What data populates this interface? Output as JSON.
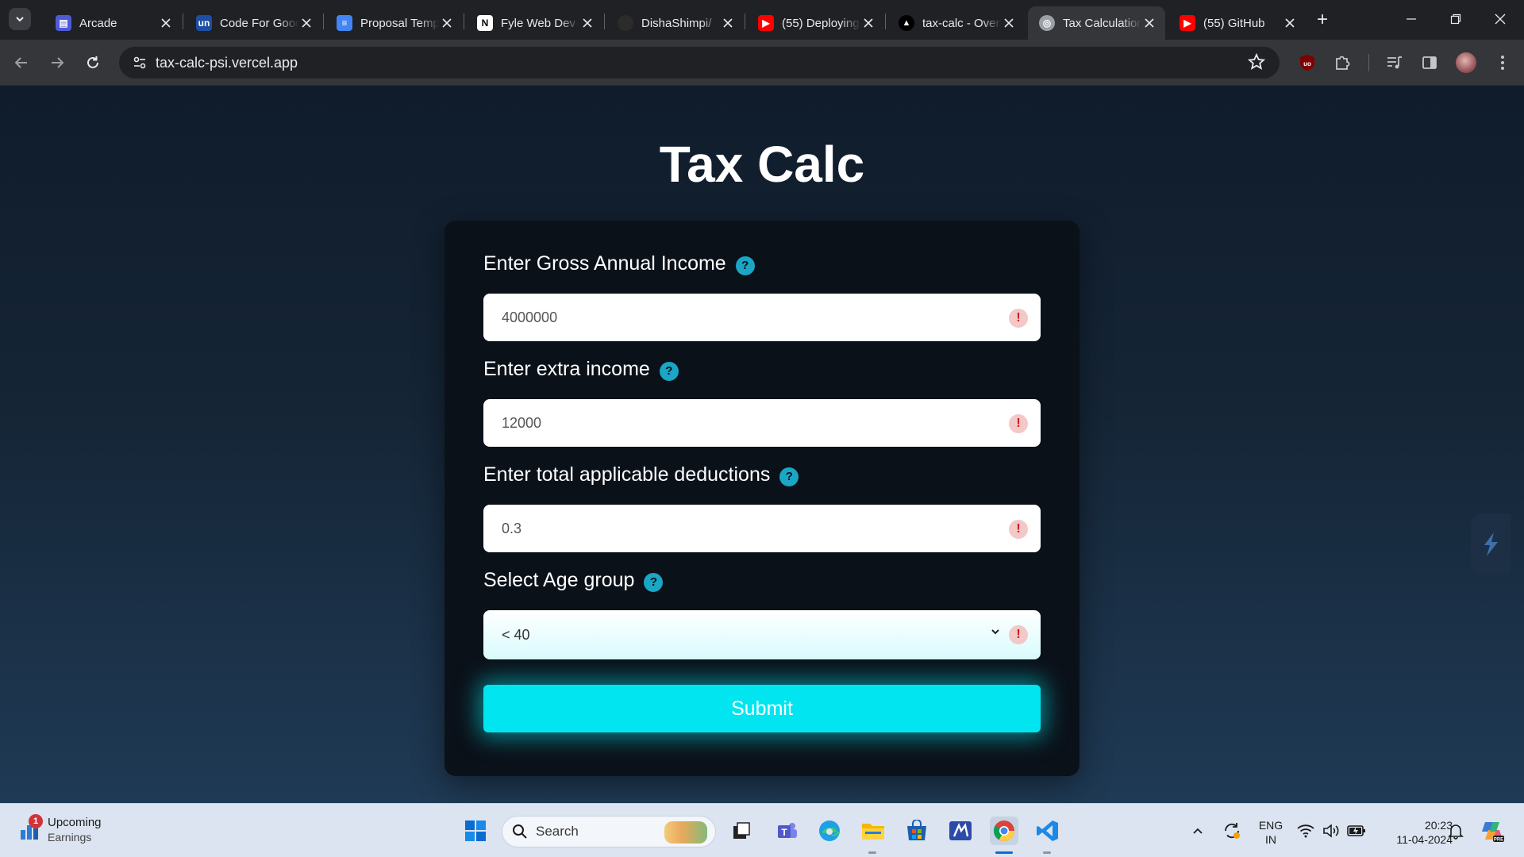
{
  "browser": {
    "tabs": [
      {
        "title": "Arcade",
        "favicon": "arcade-icon",
        "color": "#4f5bd5",
        "glyph": "▤"
      },
      {
        "title": "Code For Good",
        "favicon": "unstop-icon",
        "color": "#1c4fa3",
        "glyph": "un"
      },
      {
        "title": "Proposal Template",
        "favicon": "google-docs-icon",
        "color": "#4285f4",
        "glyph": "≡"
      },
      {
        "title": "Fyle Web Dev",
        "favicon": "notion-icon",
        "color": "#ffffff",
        "glyph": "N"
      },
      {
        "title": "DishaShimpi/",
        "favicon": "github-icon",
        "color": "#2b2b2b",
        "glyph": ""
      },
      {
        "title": "(55) Deploying",
        "favicon": "youtube-icon",
        "color": "#ff0000",
        "glyph": "▶"
      },
      {
        "title": "tax-calc - Overview",
        "favicon": "vercel-icon",
        "color": "#ffffff",
        "glyph": "▲"
      },
      {
        "title": "Tax Calculation",
        "favicon": "globe-icon",
        "color": "#9aa0a6",
        "glyph": "◎"
      },
      {
        "title": "(55) GitHub",
        "favicon": "youtube-icon",
        "color": "#ff0000",
        "glyph": "▶"
      }
    ],
    "active_tab": 7,
    "url": "tax-calc-psi.vercel.app"
  },
  "page": {
    "title": "Tax Calc",
    "help_glyph": "?",
    "warn_glyph": "!",
    "fields": [
      {
        "label": "Enter Gross Annual Income",
        "value": "4000000"
      },
      {
        "label": "Enter extra income",
        "value": "12000"
      },
      {
        "label": "Enter total applicable deductions",
        "value": "0.3"
      }
    ],
    "age_group": {
      "label": "Select Age group",
      "selected": "< 40"
    },
    "submit_label": "Submit",
    "accent_color": "#00e5f0"
  },
  "taskbar": {
    "weather_badge": "1",
    "weather_line1": "Upcoming",
    "weather_line2": "Earnings",
    "search_label": "Search",
    "lang_line1": "ENG",
    "lang_line2": "IN",
    "time": "20:23",
    "date": "11-04-2024"
  }
}
